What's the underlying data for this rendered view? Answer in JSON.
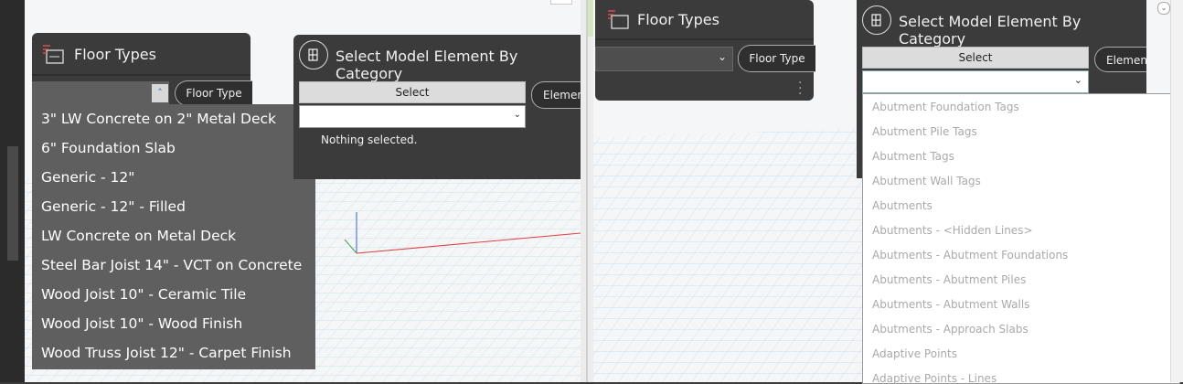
{
  "left_panel": {
    "floor_types_node": {
      "title": "Floor Types",
      "output_port_label": "Floor Type",
      "dropdown_items": [
        "3\" LW Concrete on 2\" Metal Deck",
        "6\" Foundation Slab",
        "Generic - 12\"",
        "Generic - 12\" - Filled",
        "LW Concrete on Metal Deck",
        "Steel Bar Joist 14\" - VCT on Concrete",
        "Wood Joist 10\" - Ceramic Tile",
        "Wood Joist 10\" - Wood Finish",
        "Wood Truss  Joist 12\" - Carpet Finish"
      ]
    },
    "select_node": {
      "title": "Select Model Element By Category",
      "select_label": "Select",
      "output_port_label": "Element",
      "status_text": "Nothing selected."
    }
  },
  "right_panel": {
    "floor_types_node": {
      "title": "Floor Types",
      "output_port_label": "Floor Type"
    },
    "select_node": {
      "title": "Select Model Element By Category",
      "select_label": "Select",
      "output_port_label": "Elemen",
      "category_list": [
        "Abutment Foundation Tags",
        "Abutment Pile Tags",
        "Abutment Tags",
        "Abutment Wall Tags",
        "Abutments",
        "Abutments - <Hidden Lines>",
        "Abutments - Abutment Foundations",
        "Abutments - Abutment Piles",
        "Abutments - Abutment Walls",
        "Abutments - Approach Slabs",
        "Adaptive Points",
        "Adaptive Points - Lines"
      ]
    }
  },
  "colors": {
    "node_bg": "#3b3b3b",
    "dropdown_bg": "#5f5f5f",
    "axis_x": "#e04040",
    "axis_y": "#4060d0",
    "grid": "#c6dbe6"
  }
}
